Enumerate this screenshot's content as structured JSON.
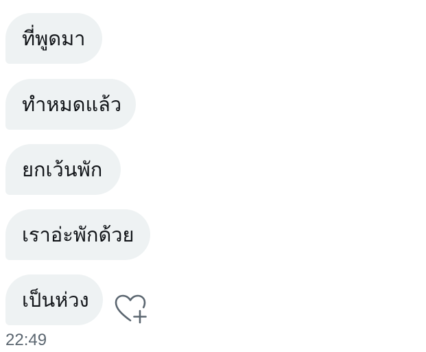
{
  "messages": [
    {
      "text": "ที่พูดมา"
    },
    {
      "text": "ทำหมดแล้ว"
    },
    {
      "text": "ยกเว้นพัก"
    },
    {
      "text": "เราอ่ะพักด้วย"
    },
    {
      "text": "เป็นห่วง"
    }
  ],
  "reaction_button": {
    "icon": "heart-plus-icon"
  },
  "timestamp": "22:49",
  "colors": {
    "bubble_bg": "#eef2f3",
    "text": "#111418",
    "timestamp": "#5b6670",
    "icon": "#5b6670"
  }
}
